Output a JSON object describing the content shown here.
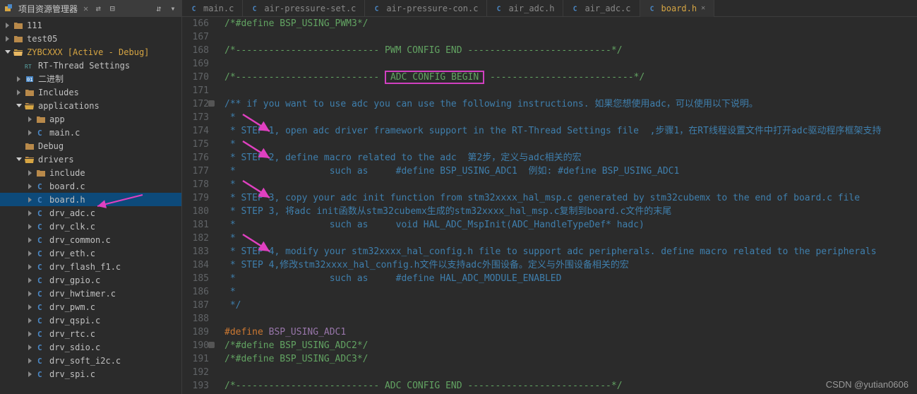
{
  "sidebar": {
    "title": "项目资源管理器",
    "icons": [
      "link-icon",
      "collapse-icon",
      "nav-icon",
      "menu-icon"
    ],
    "tree": [
      {
        "d": 0,
        "t": "tri",
        "i": "folder",
        "l": "111"
      },
      {
        "d": 0,
        "t": "tri",
        "i": "folder",
        "l": "test05"
      },
      {
        "d": 0,
        "t": "triO",
        "i": "folderA",
        "l": "ZYBCXXX",
        "suf": "  [Active - Debug]"
      },
      {
        "d": 1,
        "t": "",
        "i": "rt",
        "l": "RT-Thread Settings"
      },
      {
        "d": 1,
        "t": "tri",
        "i": "bin",
        "l": "二进制"
      },
      {
        "d": 1,
        "t": "tri",
        "i": "folder",
        "l": "Includes"
      },
      {
        "d": 1,
        "t": "triO",
        "i": "folderO",
        "l": "applications"
      },
      {
        "d": 2,
        "t": "tri",
        "i": "folder",
        "l": "app"
      },
      {
        "d": 2,
        "t": "tri",
        "i": "c",
        "l": "main.c"
      },
      {
        "d": 1,
        "t": "",
        "i": "folder",
        "l": "Debug"
      },
      {
        "d": 1,
        "t": "triO",
        "i": "folderO",
        "l": "drivers"
      },
      {
        "d": 2,
        "t": "tri",
        "i": "folder",
        "l": "include"
      },
      {
        "d": 2,
        "t": "tri",
        "i": "c",
        "l": "board.c"
      },
      {
        "d": 2,
        "t": "tri",
        "i": "c",
        "l": "board.h",
        "sel": true
      },
      {
        "d": 2,
        "t": "tri",
        "i": "c",
        "l": "drv_adc.c"
      },
      {
        "d": 2,
        "t": "tri",
        "i": "c",
        "l": "drv_clk.c"
      },
      {
        "d": 2,
        "t": "tri",
        "i": "c",
        "l": "drv_common.c"
      },
      {
        "d": 2,
        "t": "tri",
        "i": "c",
        "l": "drv_eth.c"
      },
      {
        "d": 2,
        "t": "tri",
        "i": "c",
        "l": "drv_flash_f1.c"
      },
      {
        "d": 2,
        "t": "tri",
        "i": "c",
        "l": "drv_gpio.c"
      },
      {
        "d": 2,
        "t": "tri",
        "i": "c",
        "l": "drv_hwtimer.c"
      },
      {
        "d": 2,
        "t": "tri",
        "i": "c",
        "l": "drv_pwm.c"
      },
      {
        "d": 2,
        "t": "tri",
        "i": "c",
        "l": "drv_qspi.c"
      },
      {
        "d": 2,
        "t": "tri",
        "i": "c",
        "l": "drv_rtc.c"
      },
      {
        "d": 2,
        "t": "tri",
        "i": "c",
        "l": "drv_sdio.c"
      },
      {
        "d": 2,
        "t": "tri",
        "i": "c",
        "l": "drv_soft_i2c.c"
      },
      {
        "d": 2,
        "t": "tri",
        "i": "c",
        "l": "drv_spi.c"
      }
    ]
  },
  "tabs": [
    {
      "i": "c",
      "l": "main.c"
    },
    {
      "i": "c",
      "l": "air-pressure-set.c"
    },
    {
      "i": "c",
      "l": "air-pressure-con.c"
    },
    {
      "i": "c",
      "l": "air_adc.h"
    },
    {
      "i": "c",
      "l": "air_adc.c"
    },
    {
      "i": "c",
      "l": "board.h",
      "act": true,
      "close": true
    }
  ],
  "code": {
    "start": 166,
    "lines": [
      {
        "cls": "cmnt-g",
        "t": "/*#define BSP_USING_PWM3*/"
      },
      {
        "cls": "",
        "t": ""
      },
      {
        "cls": "cmnt-g",
        "t": "/*-------------------------- PWM CONFIG END --------------------------*/"
      },
      {
        "cls": "",
        "t": ""
      },
      {
        "cls": "cmnt-g",
        "pre": "/*-------------------------- ",
        "hl": "ADC CONFIG BEGIN",
        "post": " --------------------------*/"
      },
      {
        "cls": "",
        "t": ""
      },
      {
        "cls": "cmnt",
        "fold": true,
        "t": "/** if you want to use adc you can use the following instructions. 如果您想使用adc，可以使用以下说明。"
      },
      {
        "cls": "cmnt",
        "t": " *"
      },
      {
        "cls": "cmnt",
        "t": " * STEP 1, open adc driver framework support in the RT-Thread Settings file  ,步骤1，在RT线程设置文件中打开adc驱动程序框架支持"
      },
      {
        "cls": "cmnt",
        "t": " *"
      },
      {
        "cls": "cmnt",
        "t": " * STEP 2, define macro related to the adc  第2步，定义与adc相关的宏"
      },
      {
        "cls": "cmnt",
        "t": " *                 such as     #define BSP_USING_ADC1  例如: #define BSP_USING_ADC1"
      },
      {
        "cls": "cmnt",
        "t": " *"
      },
      {
        "cls": "cmnt",
        "t": " * STEP 3, copy your adc init function from stm32xxxx_hal_msp.c generated by stm32cubemx to the end of board.c file"
      },
      {
        "cls": "cmnt",
        "t": " * STEP 3, 将adc init函数从stm32cubemx生成的stm32xxxx_hal_msp.c复制到board.c文件的末尾"
      },
      {
        "cls": "cmnt",
        "t": " *                 such as     void HAL_ADC_MspInit(ADC_HandleTypeDef* hadc)"
      },
      {
        "cls": "cmnt",
        "t": " *"
      },
      {
        "cls": "cmnt",
        "t": " * STEP 4, modify your stm32xxxx_hal_config.h file to support adc peripherals. define macro related to the peripherals"
      },
      {
        "cls": "cmnt",
        "t": " * STEP 4,修改stm32xxxx_hal_config.h文件以支持adc外围设备。定义与外围设备相关的宏"
      },
      {
        "cls": "cmnt",
        "t": " *                 such as     #define HAL_ADC_MODULE_ENABLED"
      },
      {
        "cls": "cmnt",
        "t": " *"
      },
      {
        "cls": "cmnt",
        "t": " */"
      },
      {
        "cls": "",
        "t": ""
      },
      {
        "t": "",
        "html": "<span class='kw'>#define</span> <span class='mac'>BSP_USING_ADC1</span>"
      },
      {
        "cls": "cmnt-g",
        "fold": true,
        "t": "/*#define BSP_USING_ADC2*/"
      },
      {
        "cls": "cmnt-g",
        "t": "/*#define BSP_USING_ADC3*/"
      },
      {
        "cls": "",
        "t": ""
      },
      {
        "cls": "cmnt-g",
        "t": "/*-------------------------- ADC CONFIG END --------------------------*/"
      }
    ]
  },
  "watermark": "CSDN @yutian0606"
}
